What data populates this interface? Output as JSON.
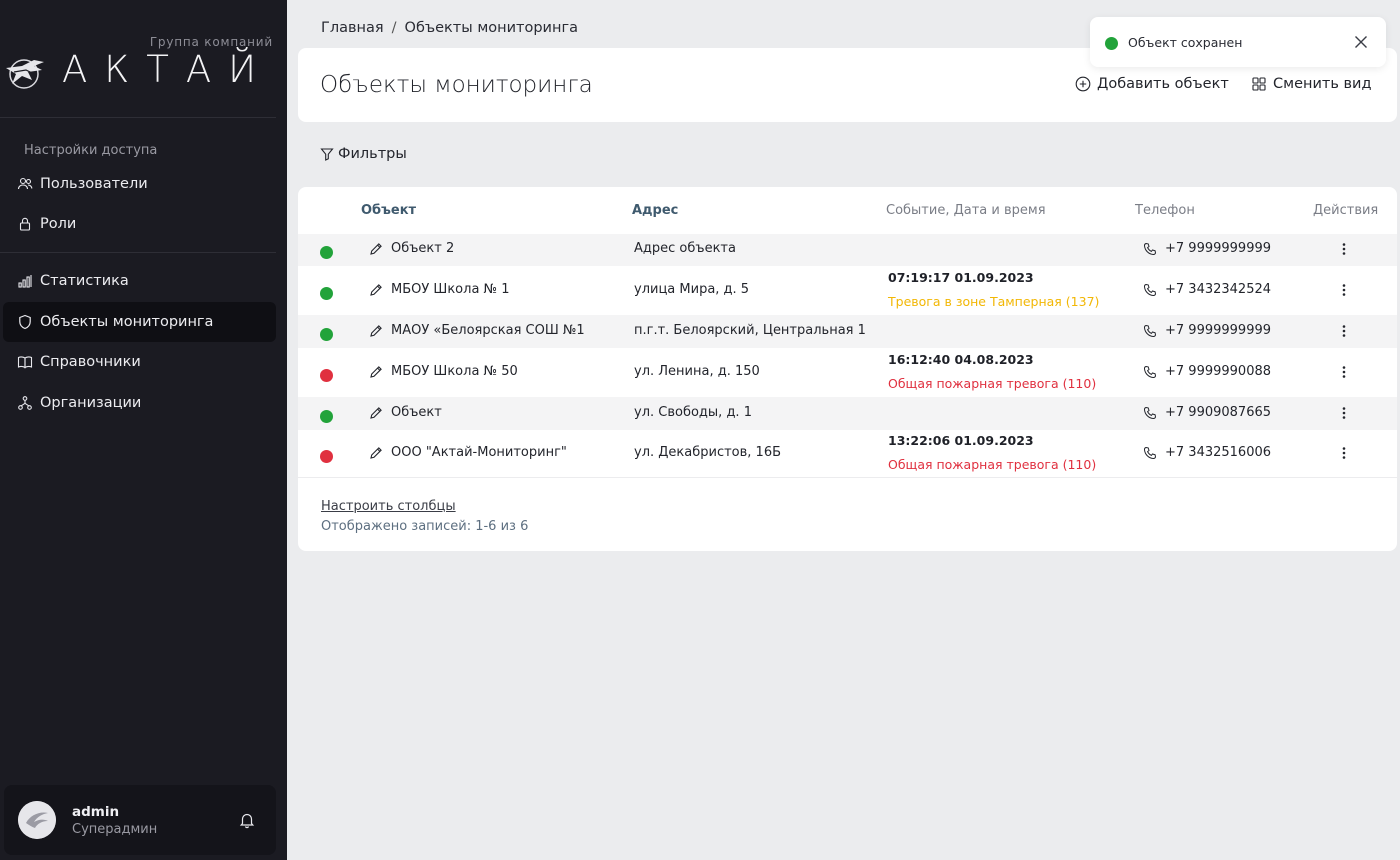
{
  "logo": {
    "subtitle": "Группа компаний",
    "name": "АКТАЙ"
  },
  "sidebar": {
    "section_title": "Настройки доступа",
    "items": [
      {
        "label": "Пользователи",
        "icon": "users-icon",
        "active": false
      },
      {
        "label": "Роли",
        "icon": "lock-icon",
        "active": false
      },
      {
        "label": "Статистика",
        "icon": "bar-chart-icon",
        "active": false
      },
      {
        "label": "Объекты мониторинга",
        "icon": "shield-icon",
        "active": true
      },
      {
        "label": "Справочники",
        "icon": "book-icon",
        "active": false
      },
      {
        "label": "Организации",
        "icon": "org-tree-icon",
        "active": false
      }
    ]
  },
  "user": {
    "name": "admin",
    "role": "Суперадмин"
  },
  "breadcrumb": {
    "home": "Главная",
    "separator": "/",
    "current": "Объекты мониторинга"
  },
  "header": {
    "title": "Объекты мониторинга",
    "add_label": "Добавить объект",
    "view_label": "Сменить вид"
  },
  "filters_label": "Фильтры",
  "table": {
    "columns": {
      "object": "Объект",
      "address": "Адрес",
      "event": "Событие, Дата и время",
      "phone": "Телефон",
      "actions": "Действия"
    },
    "rows": [
      {
        "status": "ok",
        "name": "Объект 2",
        "address": "Адрес объекта",
        "event_time": "",
        "event_text": "",
        "event_level": "",
        "phone": "+7 9999999999"
      },
      {
        "status": "ok",
        "name": "МБОУ Школа № 1",
        "address": "улица Мира, д. 5",
        "event_time": "07:19:17 01.09.2023",
        "event_text": "Тревога в зоне Тамперная (137)",
        "event_level": "warning",
        "phone": "+7 3432342524"
      },
      {
        "status": "ok",
        "name": "МАОУ «Белоярская СОШ №1",
        "address": "п.г.т. Белоярский, Центральная 1",
        "event_time": "",
        "event_text": "",
        "event_level": "",
        "phone": "+7 9999999999"
      },
      {
        "status": "alarm",
        "name": "МБОУ Школа № 50",
        "address": "ул. Ленина, д. 150",
        "event_time": "16:12:40 04.08.2023",
        "event_text": "Общая пожарная тревога (110)",
        "event_level": "danger",
        "phone": "+7 9999990088"
      },
      {
        "status": "ok",
        "name": "Объект",
        "address": "ул. Свободы, д. 1",
        "event_time": "",
        "event_text": "",
        "event_level": "",
        "phone": "+7 9909087665"
      },
      {
        "status": "alarm",
        "name": "ООО \"Актай-Мониторинг\"",
        "address": "ул. Декабристов, 16Б",
        "event_time": "13:22:06 01.09.2023",
        "event_text": "Общая пожарная тревога (110)",
        "event_level": "danger",
        "phone": "+7 3432516006"
      }
    ],
    "configure_columns": "Настроить столбцы",
    "records_info": "Отображено записей: 1-6 из 6"
  },
  "toast": {
    "text": "Объект сохранен"
  },
  "colors": {
    "ok": "#22a33a",
    "alarm": "#e0303f",
    "warning": "#f2b705",
    "danger": "#e0303f",
    "sidebar_bg": "#1b1b22",
    "page_bg": "#ebecee"
  }
}
